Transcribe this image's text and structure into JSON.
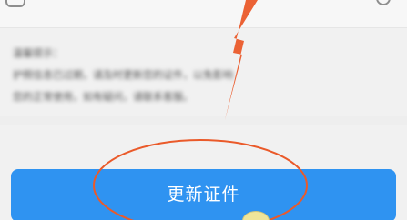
{
  "primary_button": {
    "label": "更新证件"
  },
  "notice": {
    "title": "温馨提示：",
    "lines": [
      "护照信息已过期，请及时更新您的证件，以免影响",
      "您的正常使用，如有疑问，请联系客服。"
    ]
  },
  "colors": {
    "button": "#2f93f1",
    "annotation": "#ea5a2a",
    "background": "#f1f1f1"
  },
  "icons": {
    "top_left": "back-icon",
    "top_right": "help-icon"
  }
}
